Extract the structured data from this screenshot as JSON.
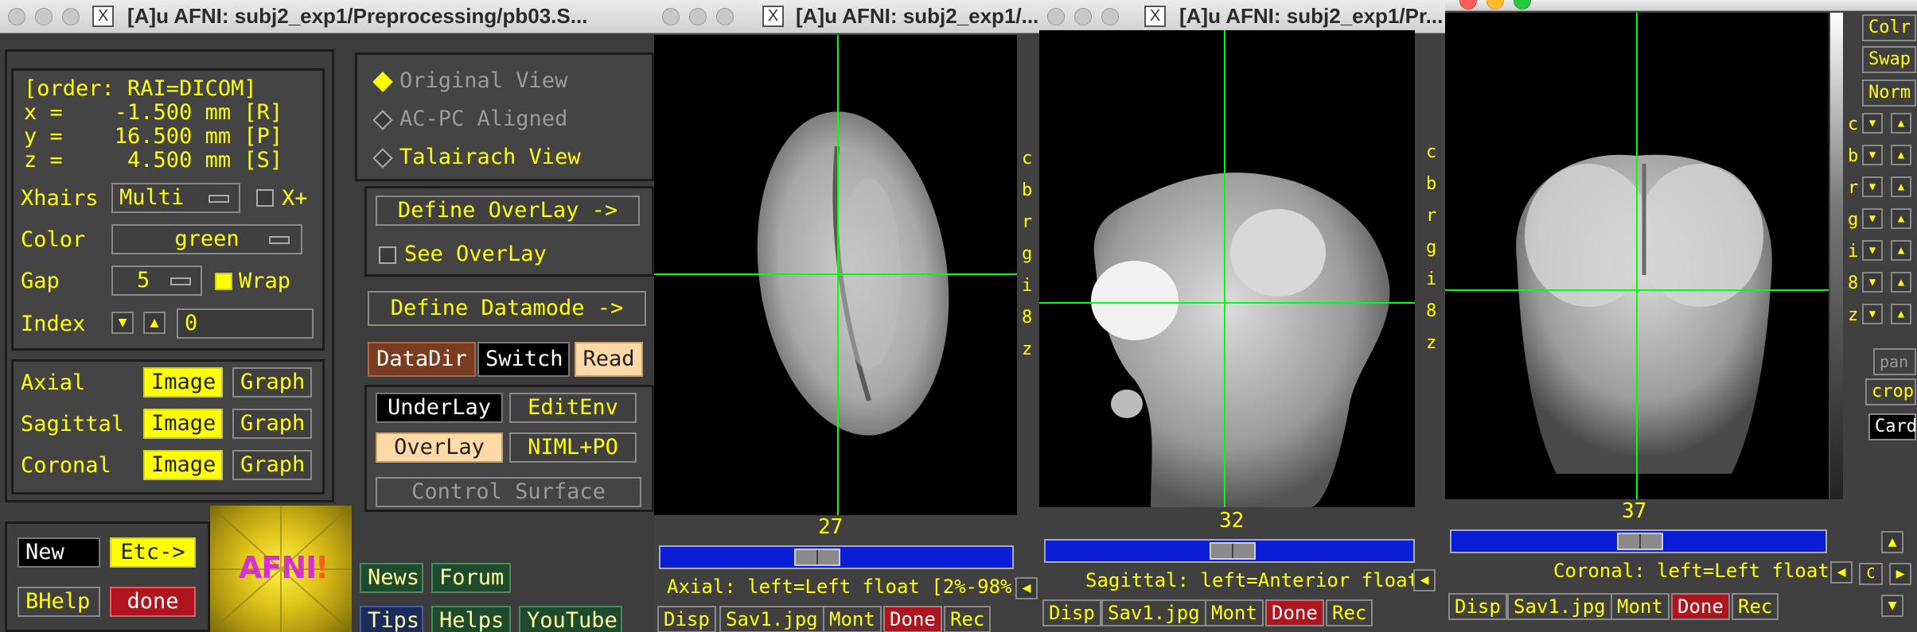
{
  "controller": {
    "title": "[A]u AFNI: subj2_exp1/Preprocessing/pb03.S...",
    "coords": {
      "order": "[order: RAI=DICOM]",
      "x": "x =    -1.500 mm [R]",
      "y": "y =    16.500 mm [P]",
      "z": "z =     4.500 mm [S]"
    },
    "xhairs_label": "Xhairs",
    "xhairs_value": "Multi",
    "xplus_label": "X+",
    "color_label": "Color",
    "color_value": "green",
    "gap_label": "Gap",
    "gap_value": "5",
    "wrap_label": "Wrap",
    "index_label": "Index",
    "index_value": "0",
    "views": [
      {
        "name": "Axial",
        "image": "Image",
        "graph": "Graph"
      },
      {
        "name": "Sagittal",
        "image": "Image",
        "graph": "Graph"
      },
      {
        "name": "Coronal",
        "image": "Image",
        "graph": "Graph"
      }
    ],
    "new": "New",
    "etc": "Etc->",
    "bhelp": "BHelp",
    "done": "done",
    "logo": "AFNI",
    "original_view": "Original View",
    "acpc": "AC-PC Aligned",
    "talairach": "Talairach View",
    "define_overlay": "Define OverLay ->",
    "see_overlay": "See OverLay",
    "define_datamode": "Define Datamode ->",
    "datadir": "DataDir",
    "switch": "Switch",
    "read": "Read",
    "underlay": "UnderLay",
    "editenv": "EditEnv",
    "overlay": "OverLay",
    "niml": "NIML+PO",
    "control_surface": "Control Surface",
    "news": "News",
    "forum": "Forum",
    "tips": "Tips",
    "helps": "Helps",
    "youtube": "YouTube"
  },
  "axial": {
    "title": "[A]u AFNI: subj2_exp1/...",
    "slice": "27",
    "info": "Axial: left=Left float [2%-98%]",
    "disp": "Disp",
    "save": "Sav1.jpg",
    "mont": "Mont",
    "done": "Done",
    "rec": "Rec"
  },
  "sagittal": {
    "title": "[A]u AFNI: subj2_exp1/Pr...",
    "slice": "32",
    "info": "Sagittal: left=Anterior float",
    "disp": "Disp",
    "save": "Sav1.jpg",
    "mont": "Mont",
    "done": "Done",
    "rec": "Rec"
  },
  "coronal": {
    "slice": "37",
    "info": "Coronal: left=Left float",
    "disp": "Disp",
    "save": "Sav1.jpg",
    "mont": "Mont",
    "done": "Done",
    "rec": "Rec",
    "side_buttons": [
      "Colr",
      "Swap",
      "Norm"
    ],
    "side_letters": [
      "c",
      "b",
      "r",
      "g",
      "i",
      "8",
      "z"
    ],
    "pan": "pan",
    "crop": "crop",
    "card": "Card",
    "c_button": "C"
  },
  "side_letters_small": [
    "c",
    "b",
    "r",
    "g",
    "i",
    "8",
    "z"
  ]
}
